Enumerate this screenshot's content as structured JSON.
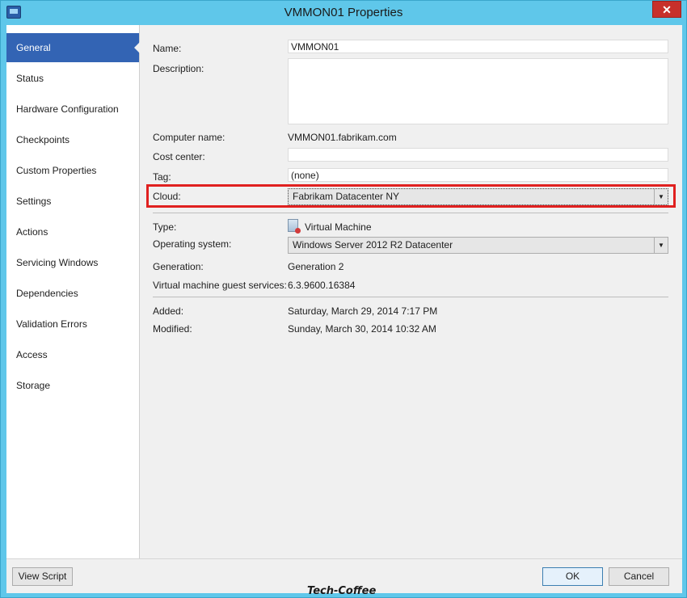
{
  "window": {
    "title": "VMMON01 Properties",
    "close_glyph": "✕"
  },
  "sidebar": {
    "items": [
      {
        "label": "General",
        "active": true
      },
      {
        "label": "Status"
      },
      {
        "label": "Hardware Configuration"
      },
      {
        "label": "Checkpoints"
      },
      {
        "label": "Custom Properties"
      },
      {
        "label": "Settings"
      },
      {
        "label": "Actions"
      },
      {
        "label": "Servicing Windows"
      },
      {
        "label": "Dependencies"
      },
      {
        "label": "Validation Errors"
      },
      {
        "label": "Access"
      },
      {
        "label": "Storage"
      }
    ]
  },
  "general": {
    "name_label": "Name:",
    "name_value": "VMMON01",
    "description_label": "Description:",
    "description_value": "",
    "computer_name_label": "Computer name:",
    "computer_name_value": "VMMON01.fabrikam.com",
    "cost_center_label": "Cost center:",
    "cost_center_value": "",
    "tag_label": "Tag:",
    "tag_value": "(none)",
    "cloud_label": "Cloud:",
    "cloud_value": "Fabrikam Datacenter NY",
    "type_label": "Type:",
    "type_value": "Virtual Machine",
    "os_label": "Operating system:",
    "os_value": "Windows Server 2012 R2 Datacenter",
    "generation_label": "Generation:",
    "generation_value": "Generation 2",
    "guest_services_label": "Virtual machine guest services:",
    "guest_services_value": "6.3.9600.16384",
    "added_label": "Added:",
    "added_value": "Saturday, March 29, 2014 7:17 PM",
    "modified_label": "Modified:",
    "modified_value": "Sunday, March 30, 2014 10:32 AM"
  },
  "footer": {
    "view_script": "View Script",
    "ok": "OK",
    "cancel": "Cancel"
  },
  "watermark": "Tech-Coffee",
  "icons": {
    "app": "app-window-icon",
    "close": "close-icon",
    "vm": "virtual-machine-icon",
    "dropdown": "chevron-down-icon"
  },
  "colors": {
    "titlebar": "#5fc7ea",
    "nav_active": "#3364b4",
    "highlight_box": "#e0201f",
    "close_button": "#c7302b"
  }
}
